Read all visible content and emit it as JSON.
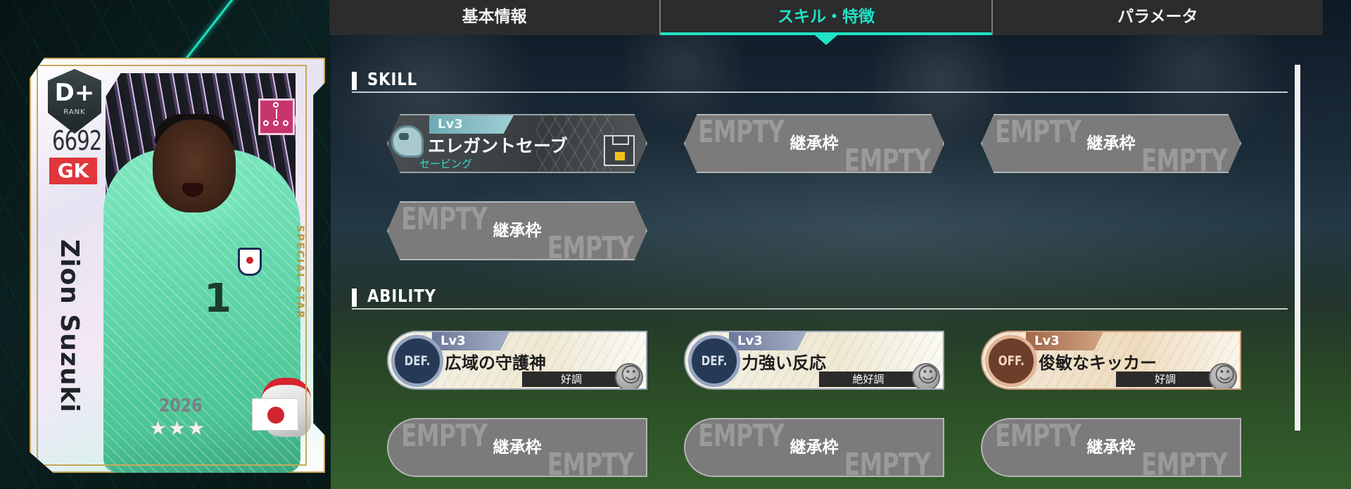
{
  "tabs": [
    {
      "label": "基本情報",
      "active": false
    },
    {
      "label": "スキル・特徴",
      "active": true
    },
    {
      "label": "パラメータ",
      "active": false
    }
  ],
  "card": {
    "rank": "D+",
    "rank_label": "RANK",
    "rating": "6692",
    "position": "GK",
    "name": "Zion Suzuki",
    "edition": "SPECIAL STAR",
    "year": "2026",
    "stars": "★★★",
    "flag_icon": "japan-flag-icon",
    "shirt_number": "1",
    "accent": "#20e2c5"
  },
  "skill_section": {
    "title": "SKILL",
    "slots": [
      {
        "type": "skill",
        "level": "Lv3",
        "name": "エレガントセーブ",
        "category": "セービング",
        "icon": "goalkeeper-glove-icon"
      },
      {
        "type": "empty",
        "watermark": "EMPTY",
        "label": "継承枠"
      },
      {
        "type": "empty",
        "watermark": "EMPTY",
        "label": "継承枠"
      },
      {
        "type": "empty",
        "watermark": "EMPTY",
        "label": "継承枠"
      }
    ]
  },
  "ability_section": {
    "title": "ABILITY",
    "slots": [
      {
        "type": "ability",
        "kind": "DEF.",
        "level": "Lv3",
        "name": "広域の守護神",
        "condition": "好調"
      },
      {
        "type": "ability",
        "kind": "DEF.",
        "level": "Lv3",
        "name": "力強い反応",
        "condition": "絶好調"
      },
      {
        "type": "ability",
        "kind": "OFF.",
        "level": "Lv3",
        "name": "俊敏なキッカー",
        "condition": "好調"
      },
      {
        "type": "empty",
        "watermark": "EMPTY",
        "label": "継承枠"
      },
      {
        "type": "empty",
        "watermark": "EMPTY",
        "label": "継承枠"
      },
      {
        "type": "empty",
        "watermark": "EMPTY",
        "label": "継承枠"
      }
    ]
  }
}
